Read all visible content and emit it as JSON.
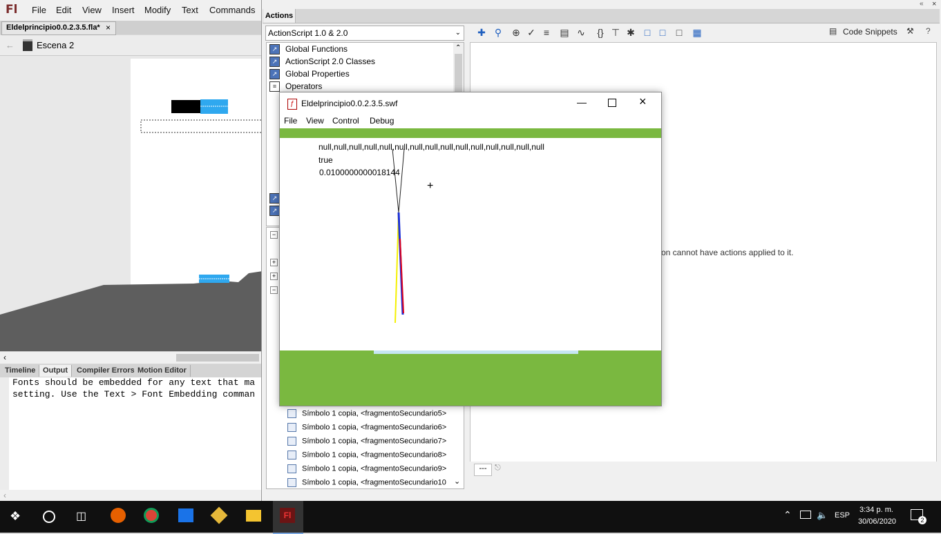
{
  "app": {
    "logo": "Fl",
    "menu": [
      "File",
      "Edit",
      "View",
      "Insert",
      "Modify",
      "Text",
      "Commands"
    ]
  },
  "document": {
    "tab_label": "Eldelprincipio0.0.2.3.5.fla*",
    "tab_close": "×",
    "scene_label": "Escena 2"
  },
  "bottom_panel": {
    "tabs": [
      "Timeline",
      "Output",
      "Compiler Errors",
      "Motion Editor"
    ],
    "active_tab": "Output",
    "output_lines": [
      "Fonts should be embedded for any text that ma",
      "setting. Use the Text > Font Embedding comman"
    ]
  },
  "actions_panel": {
    "tab_label": "Actions",
    "language_select": "ActionScript 1.0 & 2.0",
    "tree_items": [
      "Global Functions",
      "ActionScript 2.0 Classes",
      "Global Properties",
      "Operators"
    ],
    "code_snippets_label": "Code Snippets",
    "editor_message": "on cannot have actions applied to it.",
    "script_tab_label": "---",
    "symbol_items": [
      "Símbolo 1 copia, <fragmentoSecundario5>",
      "Símbolo 1 copia, <fragmentoSecundario6>",
      "Símbolo 1 copia, <fragmentoSecundario7>",
      "Símbolo 1 copia, <fragmentoSecundario8>",
      "Símbolo 1 copia, <fragmentoSecundario9>",
      "Símbolo 1 copia, <fragmentoSecundario10"
    ]
  },
  "swf_window": {
    "title": "Eldelprincipio0.0.2.3.5.swf",
    "menu": [
      "File",
      "View",
      "Control",
      "Debug"
    ],
    "trace_lines": [
      "null,null,null,null,null,null,null,null,null,null,null,null,null,null,null",
      "true",
      "0.0100000000018144"
    ],
    "colors": {
      "ground": "#7ab840",
      "water": "#c6e6f3",
      "red": "#e0001a",
      "blue": "#1b2fd6",
      "yellow": "#f4f000"
    }
  },
  "taskbar": {
    "language": "ESP",
    "time": "3:34 p. m.",
    "date": "30/06/2020",
    "notification_count": "2",
    "apps": [
      "windows-start",
      "cortana",
      "task-view",
      "firefox",
      "chrome",
      "photos",
      "app-5",
      "file-explorer",
      "flash"
    ]
  }
}
